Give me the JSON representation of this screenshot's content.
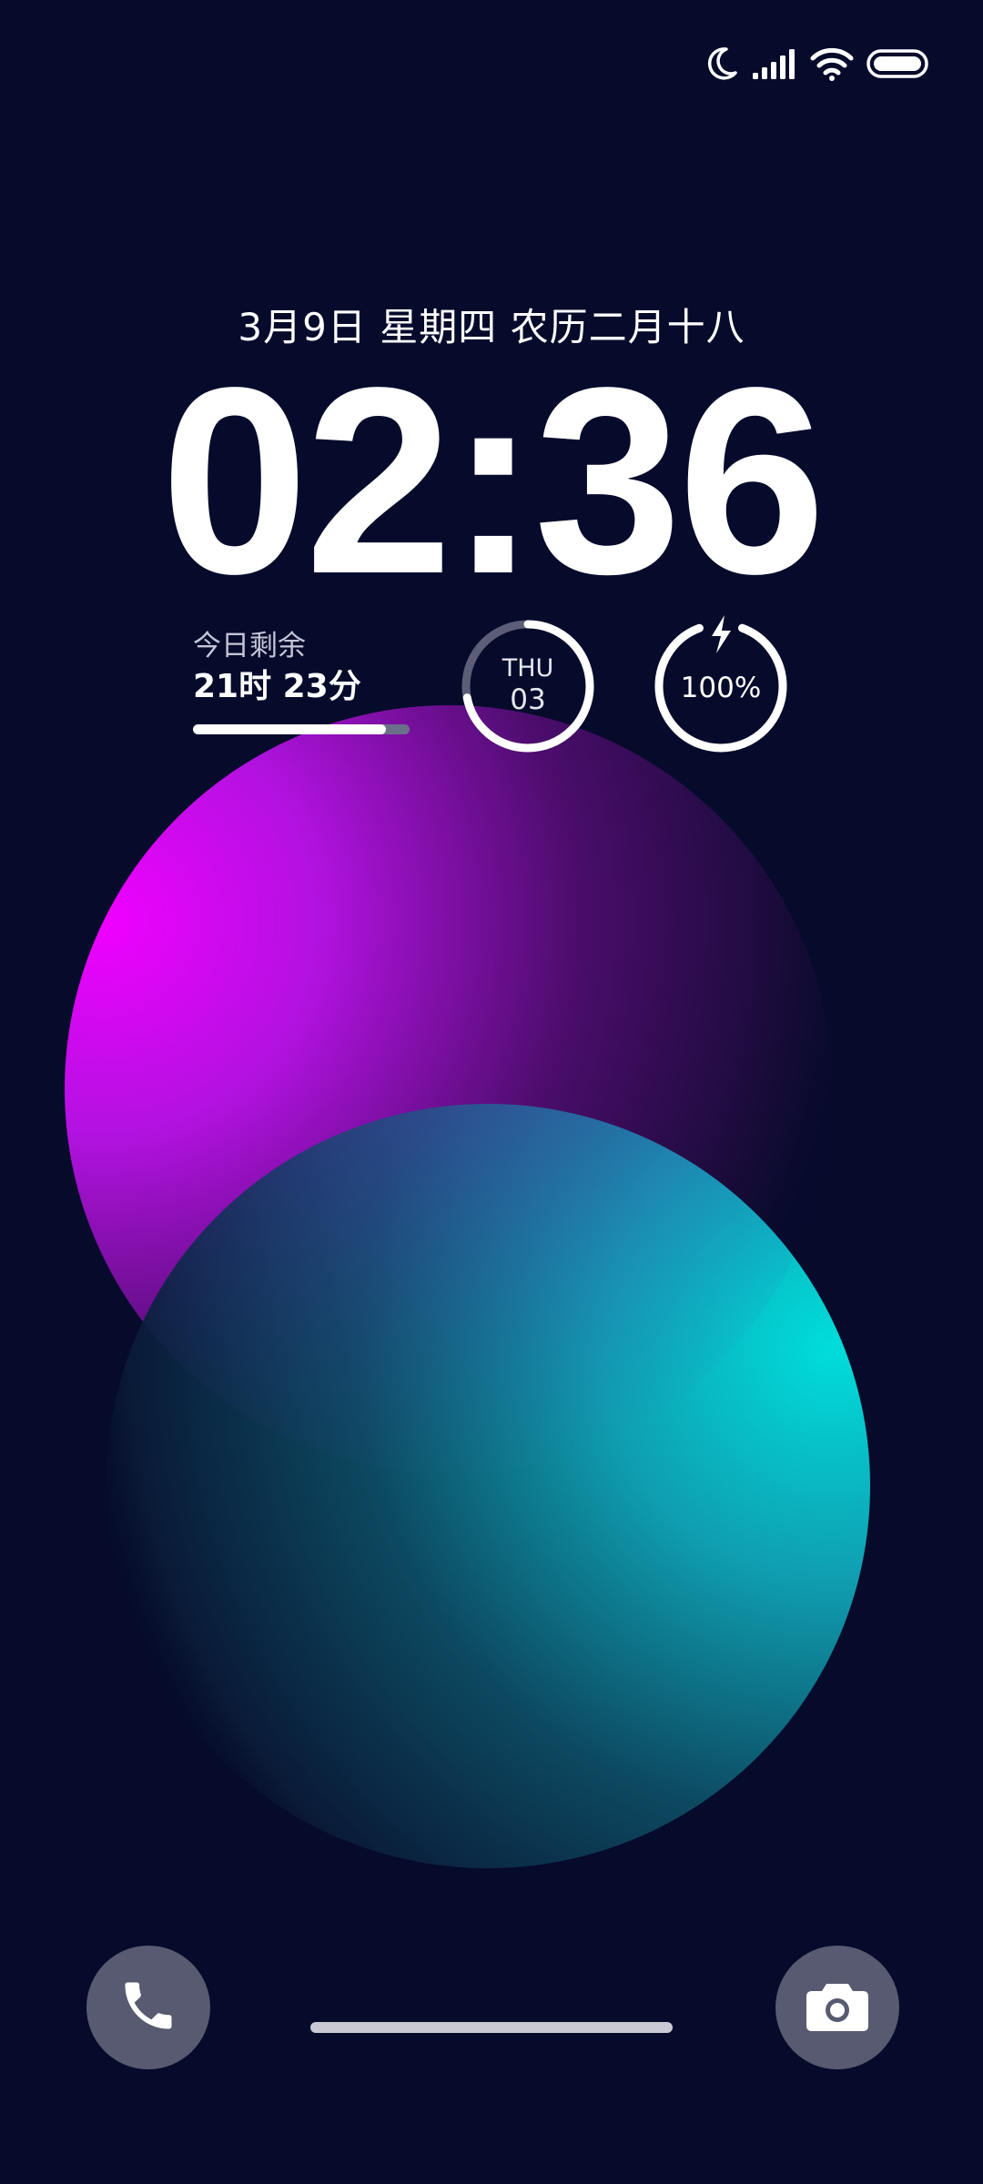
{
  "status_bar": {
    "icons": [
      "moon-icon",
      "signal-icon",
      "wifi-icon",
      "battery-icon"
    ]
  },
  "lockscreen": {
    "date": "3月9日 星期四 农历二月十八",
    "time": "02:36"
  },
  "widgets": {
    "remaining_day": {
      "label": "今日剩余",
      "value": "21时 23分",
      "progress": 0.89
    },
    "day": {
      "name": "THU",
      "number": "03",
      "progress": 0.72
    },
    "battery": {
      "percent": "100%",
      "level": 1.0,
      "charging": true
    }
  },
  "shortcuts": {
    "left": "phone-icon",
    "right": "camera-icon"
  },
  "colors": {
    "background": "#060a2b",
    "sphere_top": "#e200ff",
    "sphere_bottom": "#00e5e0",
    "button_bg": "#575a70"
  }
}
